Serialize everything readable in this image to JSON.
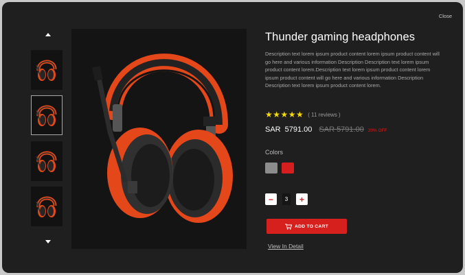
{
  "modal": {
    "close_label": "Close"
  },
  "gallery": {
    "thumbnails": [
      {
        "alt": "headphones-thumbnail-1",
        "active": false
      },
      {
        "alt": "headphones-thumbnail-2",
        "active": true
      },
      {
        "alt": "headphones-thumbnail-3",
        "active": false
      },
      {
        "alt": "headphones-thumbnail-4",
        "active": false
      }
    ],
    "up_icon": "chevron-up-icon",
    "down_icon": "chevron-down-icon"
  },
  "product": {
    "title": "Thunder gaming headphones",
    "description": "Description text lorem ipsum product content lorem ipsum product content will go here and various information Description Description text lorem ipsum product content lorem.Description text lorem ipsum product content lorem ipsum product content will go here and various information Description Description text lorem ipsum product content lorem.",
    "rating_stars": "★★★★★",
    "rating": 5,
    "reviews": "( 11 reviews )",
    "currency": "SAR",
    "price": "5791.00",
    "old_price": "SAR   5791.00",
    "discount": "20% OFF",
    "colors_label": "Colors",
    "colors": [
      "#8c8c8c",
      "#d61e1e"
    ],
    "quantity": "3",
    "add_to_cart_label": "ADD TO CART",
    "view_detail_label": "View In Detail"
  },
  "theme": {
    "accent": "#d6201d",
    "star": "#f5d90a",
    "background": "#1f1f1f"
  }
}
